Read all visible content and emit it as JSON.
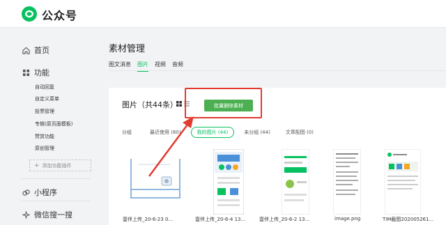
{
  "brand": {
    "name": "公众号",
    "color": "#07c160"
  },
  "sidebar": {
    "home": "首页",
    "features": "功能",
    "feature_items": [
      "自动回复",
      "自定义菜单",
      "投票管理",
      "专辑(原页面模板)",
      "赞赏功能",
      "原创管理"
    ],
    "add_plugin": "添加功能插件",
    "mini_program": "小程序",
    "search": "微信搜一搜"
  },
  "main": {
    "title": "素材管理",
    "tabs": [
      "图文消息",
      "图片",
      "视频",
      "音频"
    ],
    "active_tab": "图片",
    "panel_title": "图片（共44条）",
    "batch_delete": "批量删除素材",
    "group_label": "分组",
    "groups": [
      "最近使用 (60)",
      "我的图片 (44)",
      "未分组 (44)",
      "文章配图 (0)"
    ],
    "active_group": "我的图片 (44)",
    "images": [
      "壹伴上传_20-6-23 0...",
      "壹伴上传_20-6-4 13...",
      "壹伴上传_20-6-2 13...",
      "image.png",
      "TIM截图202005261..."
    ]
  },
  "colors": {
    "accent": "#07c160",
    "button": "#4cb052",
    "highlight": "#e23a2e"
  }
}
